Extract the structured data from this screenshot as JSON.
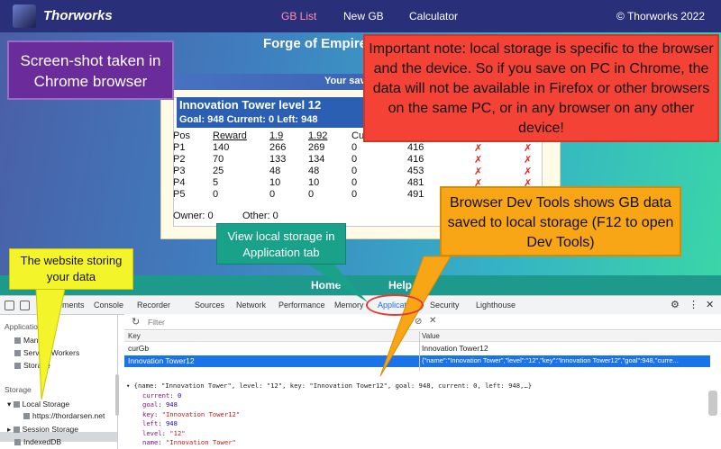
{
  "site": {
    "brand": "Thorworks",
    "nav": [
      "GB List",
      "New GB",
      "Calculator"
    ],
    "copyright": "© Thorworks 2022",
    "page_title": "Forge of Empire",
    "panel_heading": "Your sav",
    "gb": {
      "title": "Innovation Tower level 12",
      "stats": "Goal: 948   Current: 0   Left: 948",
      "headers": [
        "Pos",
        "Reward",
        "1.9",
        "1.92",
        "Cu"
      ],
      "rows": [
        {
          "pos": "P1",
          "reward": "140",
          "a": "266",
          "b": "269",
          "c": "0",
          "d": "416",
          "x1": "✗",
          "x2": "✗"
        },
        {
          "pos": "P2",
          "reward": "70",
          "a": "133",
          "b": "134",
          "c": "0",
          "d": "416",
          "x1": "✗",
          "x2": "✗"
        },
        {
          "pos": "P3",
          "reward": "25",
          "a": "48",
          "b": "48",
          "c": "0",
          "d": "453",
          "x1": "✗",
          "x2": "✗"
        },
        {
          "pos": "P4",
          "reward": "5",
          "a": "10",
          "b": "10",
          "c": "0",
          "d": "481",
          "x1": "✗",
          "x2": "✗"
        },
        {
          "pos": "P5",
          "reward": "0",
          "a": "0",
          "b": "0",
          "c": "0",
          "d": "491",
          "x1": "",
          "x2": ""
        }
      ],
      "owner": "Owner: 0",
      "other": "Other: 0"
    },
    "bottom_nav": [
      "Home",
      "Help"
    ]
  },
  "devtools": {
    "tabs": [
      "Elements",
      "Console",
      "Recorder",
      "Sources",
      "Network",
      "Performance",
      "Memory",
      "Application",
      "Security",
      "Lighthouse"
    ],
    "selected_tab": "Application",
    "sidebar": {
      "application_heading": "Application",
      "application_items": [
        "Manifest",
        "Service Workers",
        "Storage"
      ],
      "storage_heading": "Storage",
      "local_storage": "Local Storage",
      "origin": "https://thordarsen.net",
      "session_storage": "Session Storage",
      "indexeddb": "IndexedDB"
    },
    "filter_placeholder": "Filter",
    "table_headers": {
      "key": "Key",
      "value": "Value"
    },
    "entries": [
      {
        "key": "curGb",
        "value": "Innovation Tower12"
      },
      {
        "key": "Innovation Tower12",
        "value": "{\"name\":\"Innovation Tower\",\"level\":\"12\",\"key\":\"Innovation Tower12\",\"goal\":948,\"curre..."
      }
    ],
    "preview": {
      "summary": "▾ {name: \"Innovation Tower\", level: \"12\", key: \"Innovation Tower12\", goal: 948, current: 0, left: 948,…}",
      "lines": [
        {
          "k": "current",
          "v": "0",
          "t": "n"
        },
        {
          "k": "goal",
          "v": "948",
          "t": "n"
        },
        {
          "k": "key",
          "v": "\"Innovation Tower12\"",
          "t": "s"
        },
        {
          "k": "left",
          "v": "948",
          "t": "n"
        },
        {
          "k": "level",
          "v": "\"12\"",
          "t": "s"
        },
        {
          "k": "name",
          "v": "\"Innovation Tower\"",
          "t": "s"
        }
      ]
    }
  },
  "callouts": {
    "chrome": "Screen-shot taken in Chrome browser",
    "note": "Important note: local storage is specific to the browser and the device. So if you save on PC in Chrome, the data will not be available in Firefox or other browsers on the same PC, or in any browser on any other device!",
    "devtools": "Browser Dev Tools shows GB data saved to local storage (F12 to open Dev Tools)",
    "application_tab": "View local storage in Application tab",
    "website": "The website storing your data"
  }
}
